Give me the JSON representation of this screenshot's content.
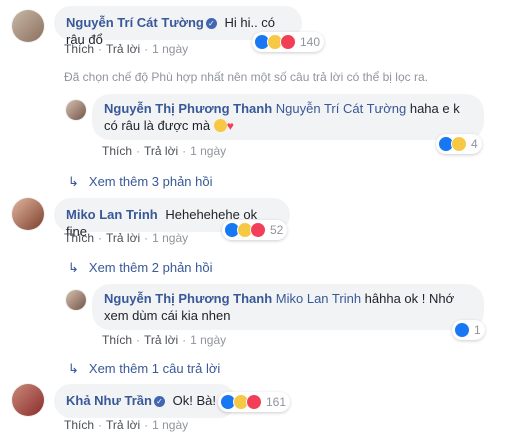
{
  "comments": [
    {
      "author": "Nguyễn Trí Cát Tường",
      "verified": true,
      "text": "Hi hi.. có râu đổ",
      "reaction_count": "140",
      "actions": {
        "like": "Thích",
        "reply": "Trả lời",
        "time": "1 ngày"
      }
    },
    {
      "author": "Nguyễn Thị Phương Thanh",
      "mention": "Nguyễn Trí Cát Tường",
      "text_line1": "haha e k",
      "text_line2": "có râu là được mà",
      "reaction_count": "4",
      "actions": {
        "like": "Thích",
        "reply": "Trả lời",
        "time": "1 ngày"
      }
    },
    {
      "author": "Miko Lan Trinh",
      "text": "Hehehehehe ok fine",
      "reaction_count": "52",
      "actions": {
        "like": "Thích",
        "reply": "Trả lời",
        "time": "1 ngày"
      }
    },
    {
      "author": "Nguyễn Thị Phương Thanh",
      "mention": "Miko Lan Trinh",
      "text_line1": "hâhha ok ! Nhớ",
      "text_line2": "xem dùm cái kia nhen",
      "reaction_count": "1",
      "actions": {
        "like": "Thích",
        "reply": "Trả lời",
        "time": "1 ngày"
      }
    },
    {
      "author": "Khả Như Trần",
      "verified": true,
      "text": "Ok! Bà!",
      "reaction_count": "161",
      "actions": {
        "like": "Thích",
        "reply": "Trả lời",
        "time": "1 ngày"
      }
    }
  ],
  "filter_note": "Đã chọn chế độ Phù hợp nhất nên một số câu trả lời có thể bị lọc ra.",
  "more_replies": {
    "first": "Xem thêm 3 phản hồi",
    "second": "Xem thêm 2 phản hồi",
    "third": "Xem thêm 1 câu trả lời"
  },
  "icons": {
    "like": "like-reaction-icon",
    "haha": "haha-reaction-icon",
    "love": "love-reaction-icon",
    "verified": "verified-badge-icon",
    "reply_arrow": "reply-arrow-icon"
  },
  "colors": {
    "name": "#385898",
    "bubble": "#f2f3f5",
    "meta": "#90949c",
    "like": "#1877f2",
    "haha": "#f7c844",
    "love": "#f33e58"
  }
}
